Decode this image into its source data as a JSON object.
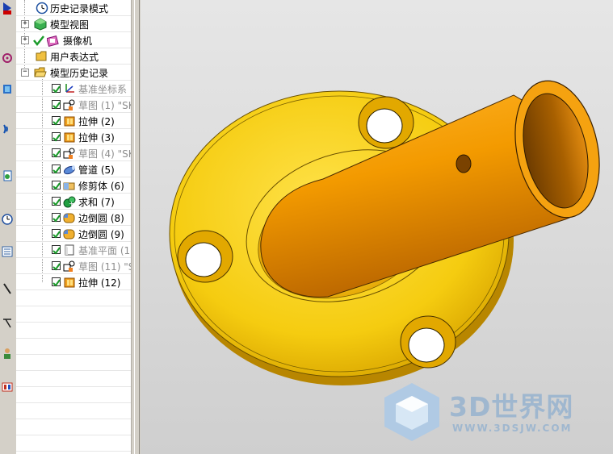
{
  "navigator": {
    "items": [
      {
        "label": "历史记录模式",
        "state": "normal"
      },
      {
        "label": "模型视图",
        "state": "normal"
      },
      {
        "label": "摄像机",
        "state": "normal"
      },
      {
        "label": "用户表达式",
        "state": "normal"
      },
      {
        "label": "模型历史记录",
        "state": "normal"
      },
      {
        "label": "基准坐标系",
        "state": "grayed"
      },
      {
        "label": "草图 (1) \"SK",
        "state": "grayed"
      },
      {
        "label": "拉伸 (2)",
        "state": "normal"
      },
      {
        "label": "拉伸 (3)",
        "state": "normal"
      },
      {
        "label": "草图 (4) \"SK",
        "state": "grayed"
      },
      {
        "label": "管道 (5)",
        "state": "normal"
      },
      {
        "label": "修剪体 (6)",
        "state": "normal"
      },
      {
        "label": "求和 (7)",
        "state": "normal"
      },
      {
        "label": "边倒圆 (8)",
        "state": "normal"
      },
      {
        "label": "边倒圆 (9)",
        "state": "normal"
      },
      {
        "label": "基准平面 (1",
        "state": "grayed"
      },
      {
        "label": "草图 (11) \"S",
        "state": "grayed"
      },
      {
        "label": "拉伸 (12)",
        "state": "normal"
      }
    ]
  },
  "toolbar": {
    "icons": [
      "navigator-icon",
      "constraints-icon",
      "assembly-icon",
      "web-icon",
      "history-icon",
      "clock-icon",
      "list-icon",
      "sketch-icon",
      "measure-icon",
      "role-icon",
      "palette-icon"
    ]
  },
  "viewport": {
    "watermark_name": "3D世界网",
    "watermark_url": "WWW.3DSJW.COM"
  },
  "colors": {
    "flange": "#f2c400",
    "pipe": "#f09600",
    "background": "#dcdcdc"
  }
}
